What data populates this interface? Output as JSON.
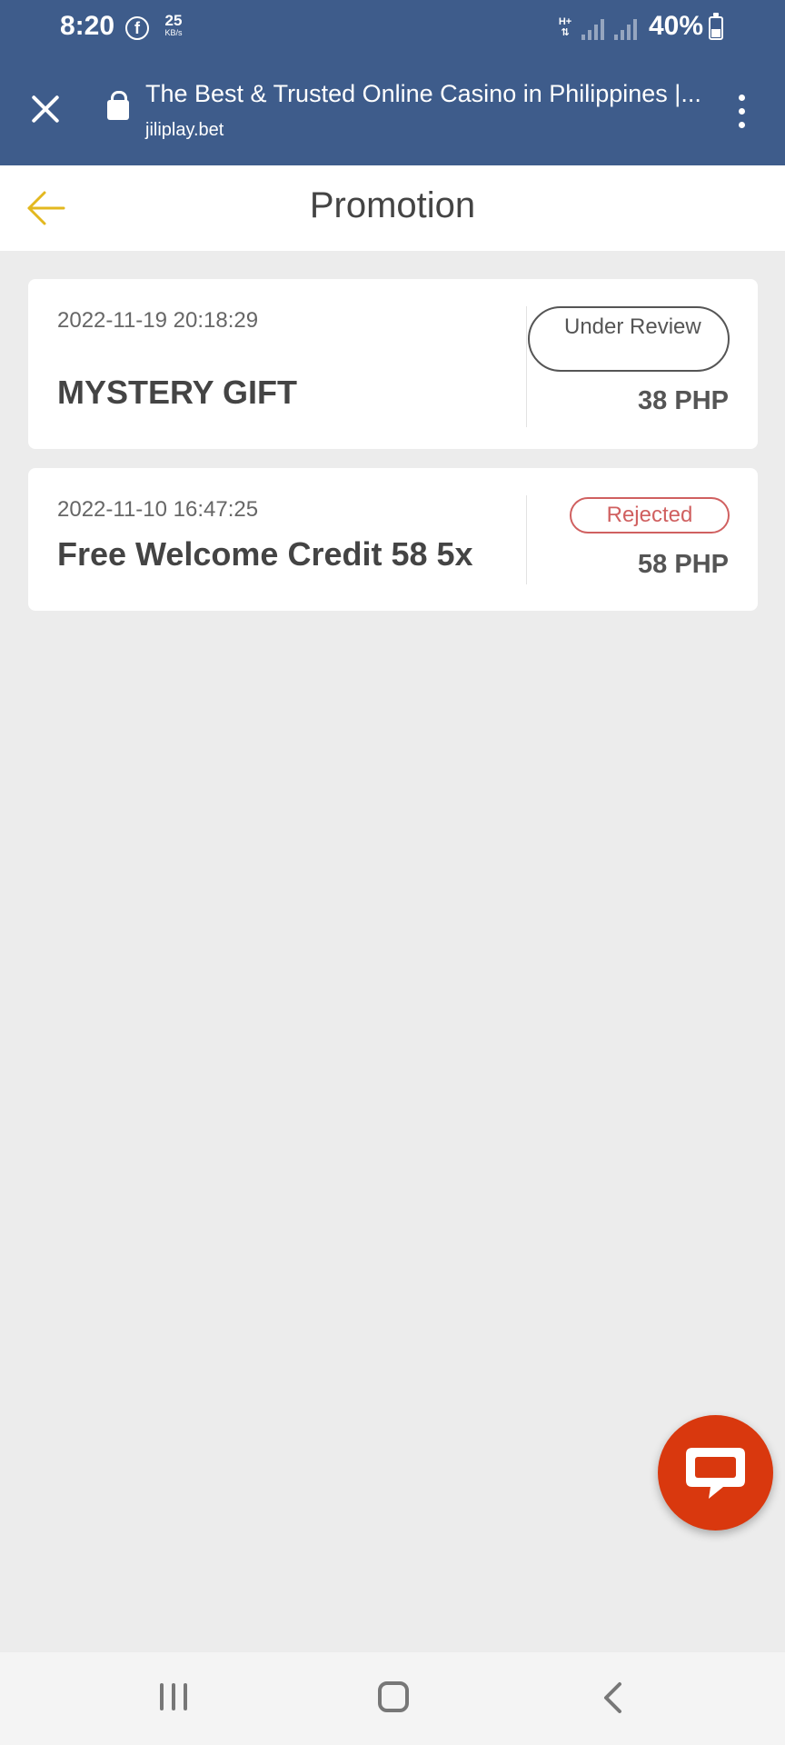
{
  "status_bar": {
    "time": "8:20",
    "facebook_glyph": "f",
    "net_speed_value": "25",
    "net_speed_unit": "KB/s",
    "network_type": "H+",
    "battery": "40%"
  },
  "browser": {
    "page_title": "The Best & Trusted Online Casino in Philippines |...",
    "url": "jiliplay.bet"
  },
  "header": {
    "title": "Promotion"
  },
  "promotions": [
    {
      "date": "2022-11-19 20:18:29",
      "name": "MYSTERY GIFT",
      "status": "Under Review",
      "amount": "38 PHP"
    },
    {
      "date": "2022-11-10 16:47:25",
      "name": "Free Welcome Credit 58 5x",
      "status": "Rejected",
      "amount": "58 PHP"
    }
  ],
  "colors": {
    "top_bar": "#3e5c8b",
    "accent_gold": "#e3b81f",
    "rejected": "#d06060",
    "chat_fab": "#d9380e",
    "background": "#ececec"
  },
  "icons": {
    "close": "close-icon",
    "lock": "lock-icon",
    "menu": "more-vert-icon",
    "back": "arrow-left-icon",
    "chat": "chat-bubble-icon",
    "nav_recents": "recents-icon",
    "nav_home": "home-icon",
    "nav_back": "back-chevron-icon"
  }
}
